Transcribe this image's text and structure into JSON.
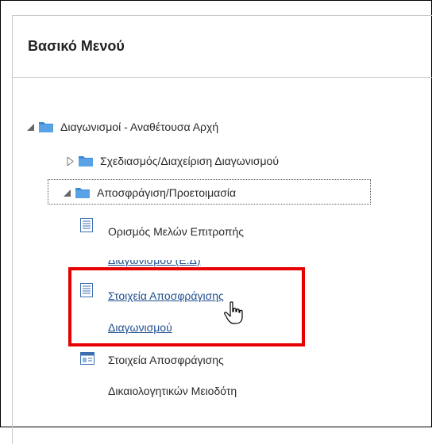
{
  "menu": {
    "title": "Βασικό Μενού"
  },
  "tree": {
    "root": {
      "label": "Διαγωνισμοί - Αναθέτουσα Αρχή",
      "expanded": true
    },
    "planning": {
      "label": "Σχεδιασμός/Διαχείριση Διαγωνισμού",
      "expanded": false
    },
    "unsealing": {
      "label": "Αποσφράγιση/Προετοιμασία",
      "expanded": true
    },
    "committee": {
      "line1": "Ορισμός Μελών Επιτροπής",
      "line2": "Διαγωνισμού (Ε.Δ)"
    },
    "tender_unsealing": {
      "line1": "Στοιχεία Αποσφράγισης",
      "line2": "Διαγωνισμού"
    },
    "supporting_docs": {
      "line1": "Στοιχεία Αποσφράγισης",
      "line2": "Δικαιολογητικών Μειοδότη"
    }
  },
  "icons": {
    "folder": "folder-icon",
    "document": "document-icon",
    "form": "form-icon",
    "cursor": "hand-pointer-icon"
  },
  "colors": {
    "highlight": "#e60000",
    "link": "#1f4f8f",
    "folder": "#3d8ad6"
  }
}
